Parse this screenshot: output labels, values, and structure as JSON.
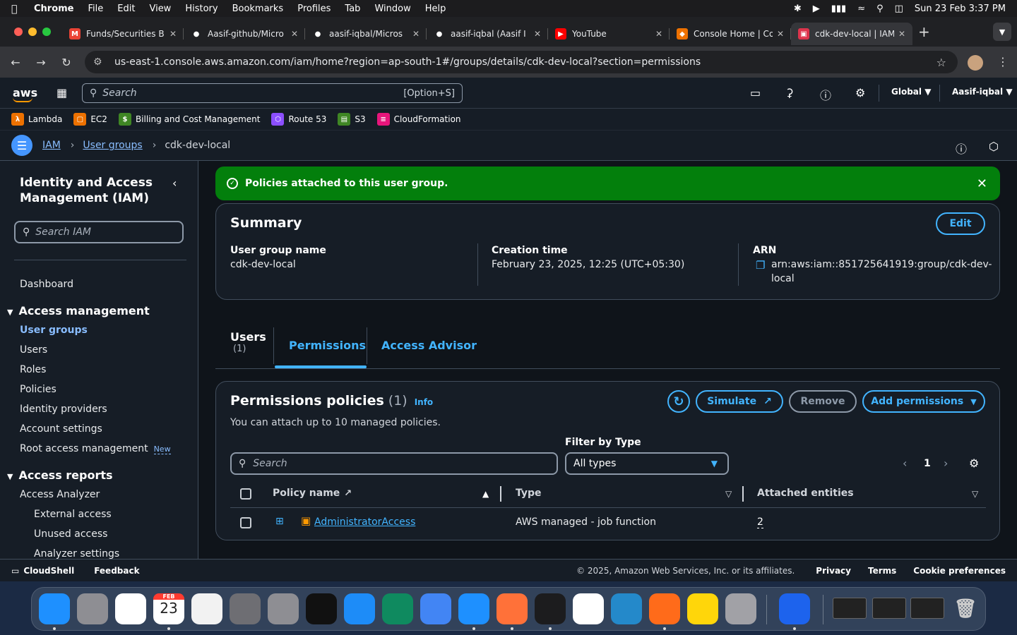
{
  "menubar": {
    "app": "Chrome",
    "items": [
      "File",
      "Edit",
      "View",
      "History",
      "Bookmarks",
      "Profiles",
      "Tab",
      "Window",
      "Help"
    ],
    "datetime": "Sun 23 Feb  3:37 PM"
  },
  "tabs": [
    {
      "title": "Funds/Securities B",
      "fav_color": "#ea4335",
      "fav_glyph": "M"
    },
    {
      "title": "Aasif-github/Micro",
      "fav_color": "#ffffff",
      "fav_glyph": "●"
    },
    {
      "title": "aasif-iqbal/Micros",
      "fav_color": "#ffffff",
      "fav_glyph": "●"
    },
    {
      "title": "aasif-iqbal (Aasif I",
      "fav_color": "#ffffff",
      "fav_glyph": "●"
    },
    {
      "title": "YouTube",
      "fav_color": "#ff0000",
      "fav_glyph": "▶"
    },
    {
      "title": "Console Home | Co",
      "fav_color": "#ed7100",
      "fav_glyph": "◆"
    },
    {
      "title": "cdk-dev-local | IAM",
      "fav_color": "#dd344c",
      "fav_glyph": "▣"
    }
  ],
  "address": {
    "url": "us-east-1.console.aws.amazon.com/iam/home?region=ap-south-1#/groups/details/cdk-dev-local?section=permissions"
  },
  "aws_header": {
    "logo": "aws",
    "search_placeholder": "Search",
    "search_shortcut": "[Option+S]",
    "region": "Global",
    "account": "Aasif-iqbal"
  },
  "favorites": [
    {
      "label": "Lambda",
      "color": "#ed7100",
      "glyph": "λ"
    },
    {
      "label": "EC2",
      "color": "#ed7100",
      "glyph": "▢"
    },
    {
      "label": "Billing and Cost Management",
      "color": "#3f8624",
      "glyph": "$"
    },
    {
      "label": "Route 53",
      "color": "#8c4fff",
      "glyph": "⬡"
    },
    {
      "label": "S3",
      "color": "#3f8624",
      "glyph": "▤"
    },
    {
      "label": "CloudFormation",
      "color": "#e7157b",
      "glyph": "≡"
    }
  ],
  "breadcrumbs": {
    "root": "IAM",
    "parent": "User groups",
    "current": "cdk-dev-local"
  },
  "sidebar": {
    "title": "Identity and Access Management (IAM)",
    "search_placeholder": "Search IAM",
    "dashboard": "Dashboard",
    "access_management": {
      "label": "Access management",
      "items": [
        "User groups",
        "Users",
        "Roles",
        "Policies",
        "Identity providers",
        "Account settings",
        "Root access management"
      ],
      "new_badge": "New"
    },
    "access_reports": {
      "label": "Access reports",
      "items": [
        "Access Analyzer"
      ],
      "sub_items": [
        "External access",
        "Unused access",
        "Analyzer settings"
      ]
    }
  },
  "flash": {
    "message": "Policies attached to this user group."
  },
  "summary": {
    "title": "Summary",
    "edit_label": "Edit",
    "group_name_label": "User group name",
    "group_name": "cdk-dev-local",
    "creation_label": "Creation time",
    "creation_time": "February 23, 2025, 12:25 (UTC+05:30)",
    "arn_label": "ARN",
    "arn_line1": "arn:aws:iam::851725641919:group/cdk-dev-",
    "arn_line2": "local"
  },
  "detail_tabs": [
    {
      "label": "Users",
      "count": "(1)"
    },
    {
      "label": "Permissions"
    },
    {
      "label": "Access Advisor"
    }
  ],
  "permissions": {
    "title": "Permissions policies",
    "count": "(1)",
    "info": "Info",
    "description": "You can attach up to 10 managed policies.",
    "simulate": "Simulate",
    "remove": "Remove",
    "add": "Add permissions",
    "search_placeholder": "Search",
    "filter_label": "Filter by Type",
    "filter_value": "All types",
    "page": "1",
    "columns": [
      "Policy name",
      "Type",
      "Attached entities"
    ],
    "rows": [
      {
        "name": "AdministratorAccess",
        "type": "AWS managed - job function",
        "entities": "2"
      }
    ]
  },
  "footer": {
    "cloudshell": "CloudShell",
    "feedback": "Feedback",
    "copyright": "© 2025, Amazon Web Services, Inc. or its affiliates.",
    "privacy": "Privacy",
    "terms": "Terms",
    "cookies": "Cookie preferences"
  },
  "dock": {
    "calendar_month": "FEB",
    "calendar_day": "23",
    "apps": [
      {
        "name": "finder",
        "color": "#1e90ff"
      },
      {
        "name": "launchpad",
        "color": "#8e8e93"
      },
      {
        "name": "easy-notepad",
        "color": "#ffffff"
      },
      {
        "name": "calendar",
        "color": "#ffffff"
      },
      {
        "name": "textedit",
        "color": "#f2f2f2"
      },
      {
        "name": "screenshot",
        "color": "#6e6e73"
      },
      {
        "name": "system-settings",
        "color": "#8e8e93"
      },
      {
        "name": "apple-tv",
        "color": "#111111"
      },
      {
        "name": "app-store",
        "color": "#1d8cf8"
      },
      {
        "name": "edge",
        "color": "#0f8a5f"
      },
      {
        "name": "chrome",
        "color": "#4285f4"
      },
      {
        "name": "safari",
        "color": "#1e90ff"
      },
      {
        "name": "firefox",
        "color": "#ff7139"
      },
      {
        "name": "terminal",
        "color": "#1c1c1e"
      },
      {
        "name": "mongodb-compass",
        "color": "#ffffff"
      },
      {
        "name": "vscode",
        "color": "#2489ca"
      },
      {
        "name": "sublime",
        "color": "#ff6b1a"
      },
      {
        "name": "notes",
        "color": "#ffd60a"
      },
      {
        "name": "system-preferences",
        "color": "#a1a1a6"
      },
      {
        "name": "docker",
        "color": "#1d63ed"
      }
    ]
  }
}
